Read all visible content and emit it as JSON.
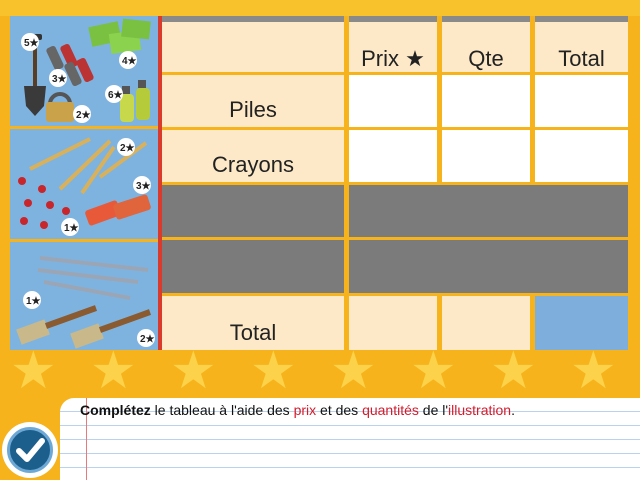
{
  "table": {
    "headers": {
      "prix": "Prix ★",
      "qte": "Qte",
      "total": "Total"
    },
    "rows": [
      {
        "label": "Piles"
      },
      {
        "label": "Crayons"
      },
      {
        "label": ""
      },
      {
        "label": ""
      },
      {
        "label": "Total"
      }
    ]
  },
  "illustration": {
    "items": [
      {
        "name": "shovel",
        "price": "5★"
      },
      {
        "name": "batteries",
        "price": "3★"
      },
      {
        "name": "envelopes",
        "price": "4★"
      },
      {
        "name": "padlock",
        "price": "2★"
      },
      {
        "name": "spray-bottles",
        "price": "6★"
      },
      {
        "name": "pencils",
        "price": "2★"
      },
      {
        "name": "pushpins",
        "price": "1★"
      },
      {
        "name": "erasers",
        "price": "3★"
      },
      {
        "name": "pens",
        "price": "1★"
      },
      {
        "name": "paintbrushes",
        "price": "2★"
      }
    ]
  },
  "instruction": {
    "bold": "Complétez",
    "part1": " le tableau à l'aide des ",
    "prix": "prix",
    "part2": " et des ",
    "quantites": "quantités",
    "part3": " de l'",
    "illustration": "illustration",
    "end": "."
  },
  "colors": {
    "background": "#f6b31c",
    "peach": "#fde9c8",
    "grey": "#7b7b7b",
    "blue": "#7eaedb",
    "red_text": "#d61b2b"
  },
  "check_button": {
    "icon": "checkmark-icon"
  }
}
